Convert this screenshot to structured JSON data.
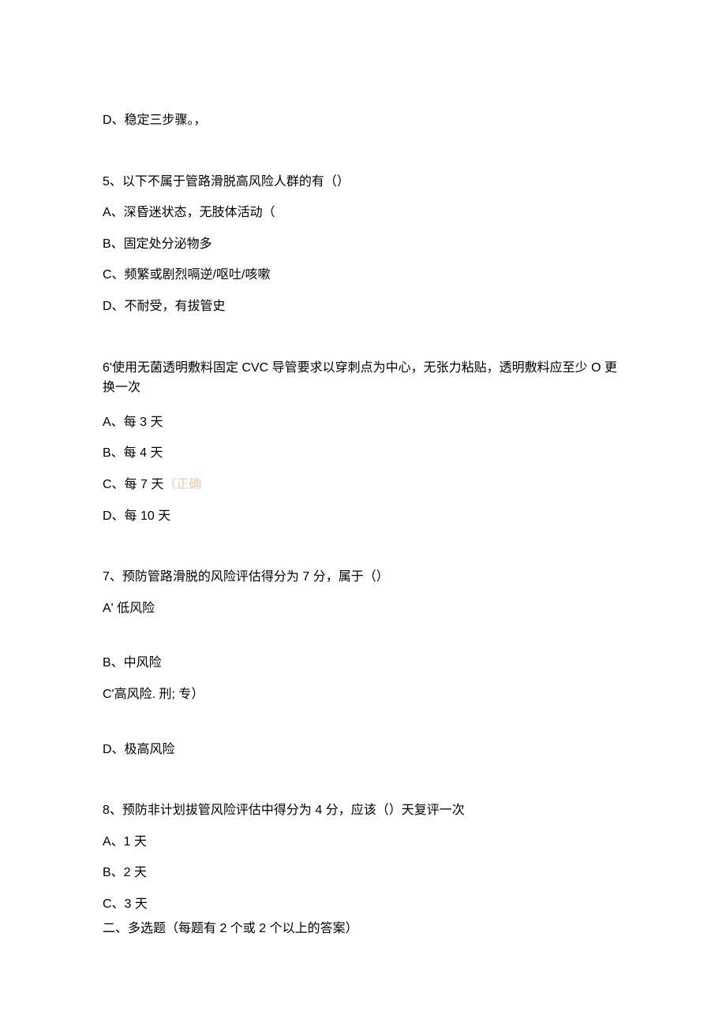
{
  "q4": {
    "optD": "D、稳定三步骤。，"
  },
  "q5": {
    "stem": "5、以下不属于管路滑脱高风险人群的有（）",
    "optA": "A、深昏迷状态，无肢体活动（",
    "optB": "B、固定处分泌物多",
    "optC": "C、频繁或剧烈嗝逆/呕吐/咳嗽",
    "optD": "D、不耐受，有拔管史"
  },
  "q6": {
    "stem": "6'使用无菌透明敷料固定 CVC 导管要求以穿刺点为中心，无张力粘贴，透明敷料应至少 O 更换一次",
    "optA": "A、每 3 天",
    "optB": "B、每 4 天",
    "optC": "C、每 7 天",
    "optC_correct": "（正确",
    "optD": "D、每 10 天"
  },
  "q7": {
    "stem": "7、预防管路滑脱的风险评估得分为 7 分，属于（）",
    "optA": "A' 低风险",
    "optB": "B、中风险",
    "optC": "C'高风险. 刑; 专）",
    "optD": "D、极高风险"
  },
  "q8": {
    "stem": "8、预防非计划拔管风险评估中得分为 4 分，应该（）天复评一次",
    "optA": "A、1 天",
    "optB": "B、2 天",
    "optC": "C、3 天"
  },
  "section2": "二、多选题（每题有 2 个或 2 个以上的答案）"
}
